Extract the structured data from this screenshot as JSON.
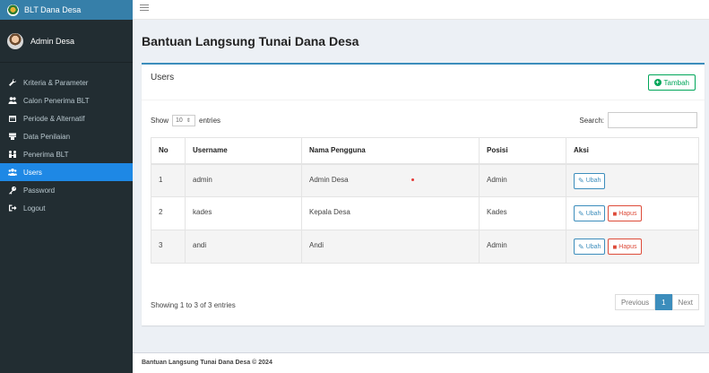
{
  "app": {
    "brand": "BLT Dana Desa",
    "user": "Admin Desa"
  },
  "sidebar": {
    "items": [
      {
        "label": "Kriteria & Parameter",
        "icon": "wrench-icon"
      },
      {
        "label": "Calon Penerima BLT",
        "icon": "users-icon"
      },
      {
        "label": "Periode & Alternatif",
        "icon": "calendar-icon"
      },
      {
        "label": "Data Penilaian",
        "icon": "document-icon"
      },
      {
        "label": "Penerima BLT",
        "icon": "user-check-icon"
      },
      {
        "label": "Users",
        "icon": "users-icon"
      },
      {
        "label": "Password",
        "icon": "key-icon"
      },
      {
        "label": "Logout",
        "icon": "logout-icon"
      }
    ],
    "active_index": 5
  },
  "page": {
    "title": "Bantuan Langsung Tunai Dana Desa",
    "box_title": "Users",
    "add_label": "Tambah"
  },
  "table_controls": {
    "show_label": "Show",
    "entries_value": "10",
    "entries_label": "entries",
    "search_label": "Search:",
    "search_value": ""
  },
  "table": {
    "headers": [
      "No",
      "Username",
      "Nama Pengguna",
      "Posisi",
      "Aksi"
    ],
    "rows": [
      {
        "no": "1",
        "username": "admin",
        "nama": "Admin Desa",
        "posisi": "Admin"
      },
      {
        "no": "2",
        "username": "kades",
        "nama": "Kepala Desa",
        "posisi": "Kades"
      },
      {
        "no": "3",
        "username": "andi",
        "nama": "Andi",
        "posisi": "Admin"
      }
    ],
    "edit_label": "Ubah",
    "delete_label": "Hapus"
  },
  "pagination": {
    "info": "Showing 1 to 3 of 3 entries",
    "prev": "Previous",
    "current": "1",
    "next": "Next"
  },
  "footer": {
    "text": "Bantuan Langsung Tunai Dana Desa © 2024"
  },
  "colors": {
    "sidebar": "#222d32",
    "brand": "#367fa9",
    "active": "#1e88e5",
    "primary": "#3c8dbc",
    "success": "#00a65a",
    "danger": "#dd4b39"
  }
}
